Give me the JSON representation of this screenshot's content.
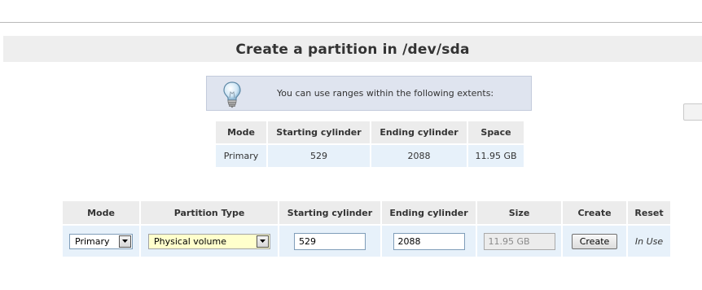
{
  "page": {
    "title": "Create a partition in /dev/sda"
  },
  "info": {
    "icon": "lightbulb-icon",
    "message": "You can use ranges within the following extents:"
  },
  "extents_table": {
    "headers": [
      "Mode",
      "Starting cylinder",
      "Ending cylinder",
      "Space"
    ],
    "rows": [
      [
        "Primary",
        "529",
        "2088",
        "11.95 GB"
      ]
    ]
  },
  "create_table": {
    "headers": [
      "Mode",
      "Partition Type",
      "Starting cylinder",
      "Ending cylinder",
      "Size",
      "Create",
      "Reset"
    ],
    "mode_value": "Primary",
    "partition_type_value": "Physical volume",
    "start_value": "529",
    "end_value": "2088",
    "size_value": "11.95 GB",
    "create_button": "Create",
    "reset_text": "In Use"
  },
  "colors": {
    "header_bg": "#ececec",
    "cell_bg": "#e7f1fa",
    "info_bg": "#dfe4ef",
    "highlight_select": "#ffffcc"
  }
}
